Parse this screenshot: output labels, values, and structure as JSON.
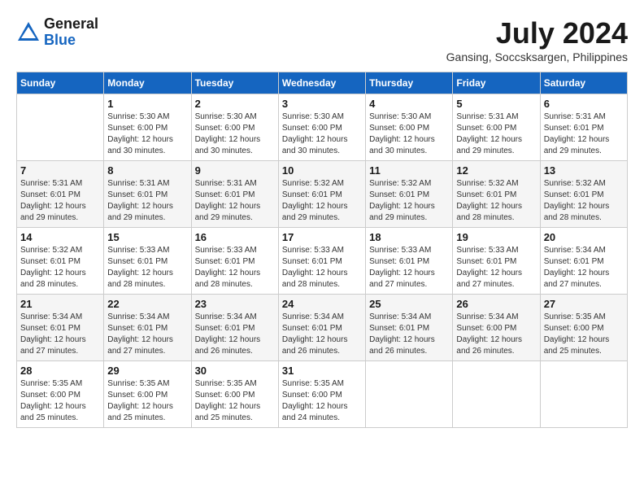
{
  "header": {
    "logo_general": "General",
    "logo_blue": "Blue",
    "month_year": "July 2024",
    "location": "Gansing, Soccsksargen, Philippines"
  },
  "calendar": {
    "days_of_week": [
      "Sunday",
      "Monday",
      "Tuesday",
      "Wednesday",
      "Thursday",
      "Friday",
      "Saturday"
    ],
    "weeks": [
      [
        {
          "day": "",
          "info": ""
        },
        {
          "day": "1",
          "info": "Sunrise: 5:30 AM\nSunset: 6:00 PM\nDaylight: 12 hours\nand 30 minutes."
        },
        {
          "day": "2",
          "info": "Sunrise: 5:30 AM\nSunset: 6:00 PM\nDaylight: 12 hours\nand 30 minutes."
        },
        {
          "day": "3",
          "info": "Sunrise: 5:30 AM\nSunset: 6:00 PM\nDaylight: 12 hours\nand 30 minutes."
        },
        {
          "day": "4",
          "info": "Sunrise: 5:30 AM\nSunset: 6:00 PM\nDaylight: 12 hours\nand 30 minutes."
        },
        {
          "day": "5",
          "info": "Sunrise: 5:31 AM\nSunset: 6:00 PM\nDaylight: 12 hours\nand 29 minutes."
        },
        {
          "day": "6",
          "info": "Sunrise: 5:31 AM\nSunset: 6:01 PM\nDaylight: 12 hours\nand 29 minutes."
        }
      ],
      [
        {
          "day": "7",
          "info": "Sunrise: 5:31 AM\nSunset: 6:01 PM\nDaylight: 12 hours\nand 29 minutes."
        },
        {
          "day": "8",
          "info": "Sunrise: 5:31 AM\nSunset: 6:01 PM\nDaylight: 12 hours\nand 29 minutes."
        },
        {
          "day": "9",
          "info": "Sunrise: 5:31 AM\nSunset: 6:01 PM\nDaylight: 12 hours\nand 29 minutes."
        },
        {
          "day": "10",
          "info": "Sunrise: 5:32 AM\nSunset: 6:01 PM\nDaylight: 12 hours\nand 29 minutes."
        },
        {
          "day": "11",
          "info": "Sunrise: 5:32 AM\nSunset: 6:01 PM\nDaylight: 12 hours\nand 29 minutes."
        },
        {
          "day": "12",
          "info": "Sunrise: 5:32 AM\nSunset: 6:01 PM\nDaylight: 12 hours\nand 28 minutes."
        },
        {
          "day": "13",
          "info": "Sunrise: 5:32 AM\nSunset: 6:01 PM\nDaylight: 12 hours\nand 28 minutes."
        }
      ],
      [
        {
          "day": "14",
          "info": "Sunrise: 5:32 AM\nSunset: 6:01 PM\nDaylight: 12 hours\nand 28 minutes."
        },
        {
          "day": "15",
          "info": "Sunrise: 5:33 AM\nSunset: 6:01 PM\nDaylight: 12 hours\nand 28 minutes."
        },
        {
          "day": "16",
          "info": "Sunrise: 5:33 AM\nSunset: 6:01 PM\nDaylight: 12 hours\nand 28 minutes."
        },
        {
          "day": "17",
          "info": "Sunrise: 5:33 AM\nSunset: 6:01 PM\nDaylight: 12 hours\nand 28 minutes."
        },
        {
          "day": "18",
          "info": "Sunrise: 5:33 AM\nSunset: 6:01 PM\nDaylight: 12 hours\nand 27 minutes."
        },
        {
          "day": "19",
          "info": "Sunrise: 5:33 AM\nSunset: 6:01 PM\nDaylight: 12 hours\nand 27 minutes."
        },
        {
          "day": "20",
          "info": "Sunrise: 5:34 AM\nSunset: 6:01 PM\nDaylight: 12 hours\nand 27 minutes."
        }
      ],
      [
        {
          "day": "21",
          "info": "Sunrise: 5:34 AM\nSunset: 6:01 PM\nDaylight: 12 hours\nand 27 minutes."
        },
        {
          "day": "22",
          "info": "Sunrise: 5:34 AM\nSunset: 6:01 PM\nDaylight: 12 hours\nand 27 minutes."
        },
        {
          "day": "23",
          "info": "Sunrise: 5:34 AM\nSunset: 6:01 PM\nDaylight: 12 hours\nand 26 minutes."
        },
        {
          "day": "24",
          "info": "Sunrise: 5:34 AM\nSunset: 6:01 PM\nDaylight: 12 hours\nand 26 minutes."
        },
        {
          "day": "25",
          "info": "Sunrise: 5:34 AM\nSunset: 6:01 PM\nDaylight: 12 hours\nand 26 minutes."
        },
        {
          "day": "26",
          "info": "Sunrise: 5:34 AM\nSunset: 6:00 PM\nDaylight: 12 hours\nand 26 minutes."
        },
        {
          "day": "27",
          "info": "Sunrise: 5:35 AM\nSunset: 6:00 PM\nDaylight: 12 hours\nand 25 minutes."
        }
      ],
      [
        {
          "day": "28",
          "info": "Sunrise: 5:35 AM\nSunset: 6:00 PM\nDaylight: 12 hours\nand 25 minutes."
        },
        {
          "day": "29",
          "info": "Sunrise: 5:35 AM\nSunset: 6:00 PM\nDaylight: 12 hours\nand 25 minutes."
        },
        {
          "day": "30",
          "info": "Sunrise: 5:35 AM\nSunset: 6:00 PM\nDaylight: 12 hours\nand 25 minutes."
        },
        {
          "day": "31",
          "info": "Sunrise: 5:35 AM\nSunset: 6:00 PM\nDaylight: 12 hours\nand 24 minutes."
        },
        {
          "day": "",
          "info": ""
        },
        {
          "day": "",
          "info": ""
        },
        {
          "day": "",
          "info": ""
        }
      ]
    ]
  }
}
